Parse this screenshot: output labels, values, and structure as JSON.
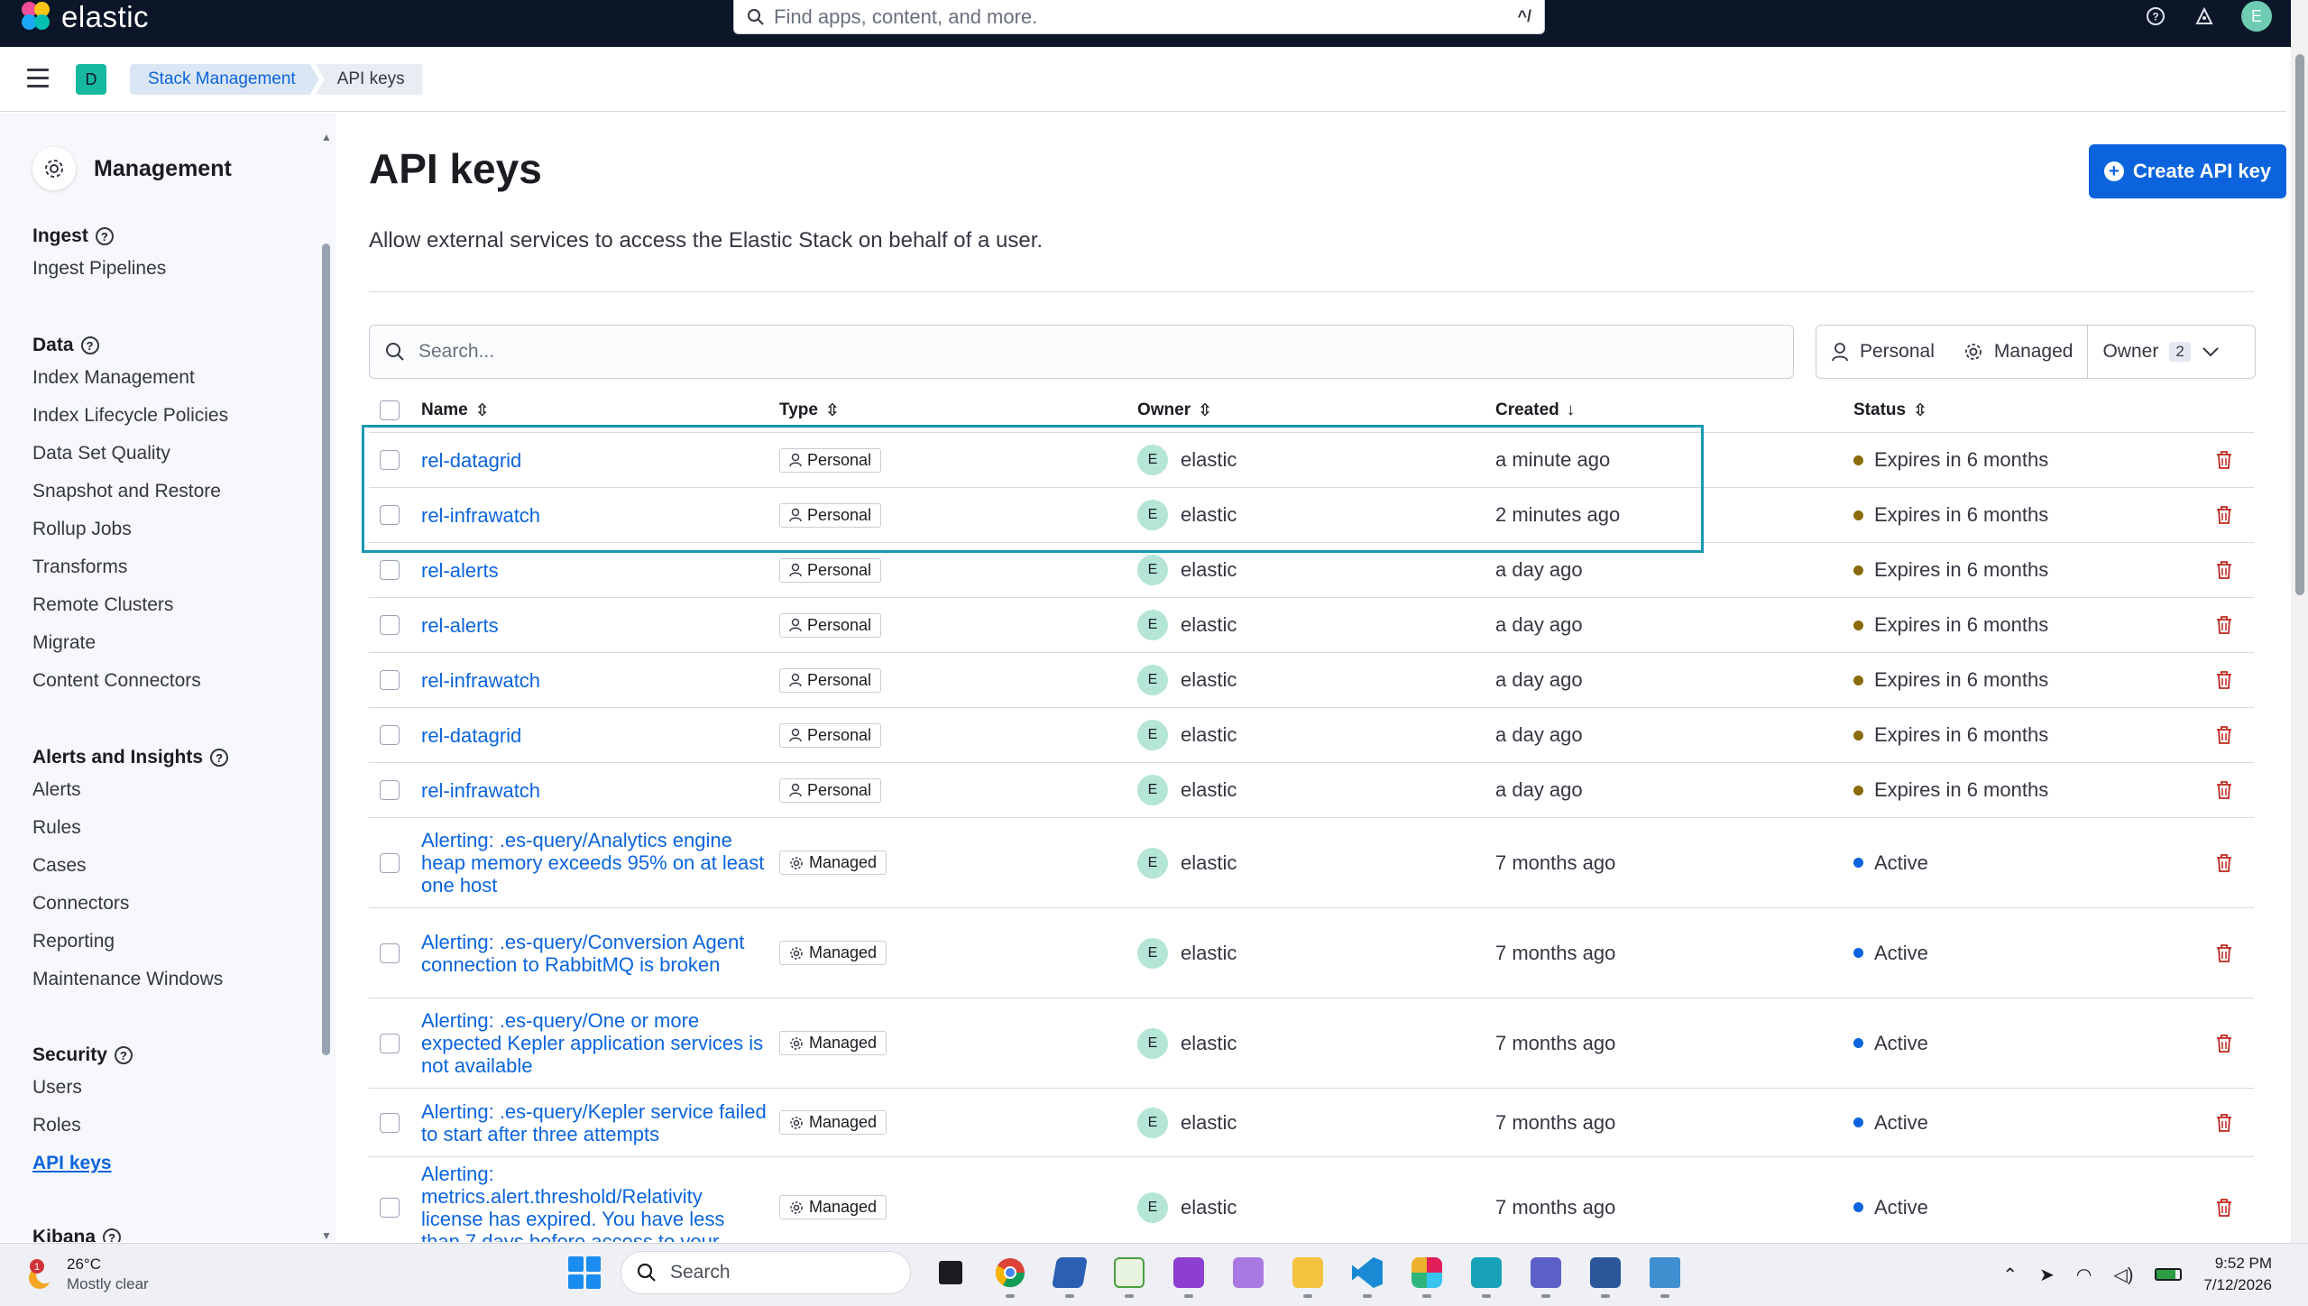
{
  "app": {
    "brand": "elastic",
    "search_placeholder": "Find apps, content, and more.",
    "search_shortcut": "^/",
    "user_initial": "E",
    "space_initial": "D"
  },
  "breadcrumbs": [
    "Stack Management",
    "API keys"
  ],
  "sidebar": {
    "title": "Management",
    "groups": [
      {
        "title": "Ingest",
        "items": [
          "Ingest Pipelines"
        ]
      },
      {
        "title": "Data",
        "items": [
          "Index Management",
          "Index Lifecycle Policies",
          "Data Set Quality",
          "Snapshot and Restore",
          "Rollup Jobs",
          "Transforms",
          "Remote Clusters",
          "Migrate",
          "Content Connectors"
        ]
      },
      {
        "title": "Alerts and Insights",
        "items": [
          "Alerts",
          "Rules",
          "Cases",
          "Connectors",
          "Reporting",
          "Maintenance Windows"
        ]
      },
      {
        "title": "Security",
        "items": [
          "Users",
          "Roles",
          "API keys"
        ]
      },
      {
        "title": "Kibana",
        "items": []
      }
    ],
    "active_item": "API keys"
  },
  "page": {
    "title": "API keys",
    "description": "Allow external services to access the Elastic Stack on behalf of a user.",
    "create_button": "Create API key",
    "search_placeholder": "Search...",
    "filters": {
      "personal": "Personal",
      "managed": "Managed",
      "owner": "Owner",
      "owner_count": "2"
    }
  },
  "table": {
    "columns": [
      "Name",
      "Type",
      "Owner",
      "Created",
      "Status"
    ],
    "rows": [
      {
        "name": "rel-datagrid",
        "type": "Personal",
        "owner": "elastic",
        "created": "a minute ago",
        "status": "Expires in 6 months"
      },
      {
        "name": "rel-infrawatch",
        "type": "Personal",
        "owner": "elastic",
        "created": "2 minutes ago",
        "status": "Expires in 6 months"
      },
      {
        "name": "rel-alerts",
        "type": "Personal",
        "owner": "elastic",
        "created": "a day ago",
        "status": "Expires in 6 months"
      },
      {
        "name": "rel-alerts",
        "type": "Personal",
        "owner": "elastic",
        "created": "a day ago",
        "status": "Expires in 6 months"
      },
      {
        "name": "rel-infrawatch",
        "type": "Personal",
        "owner": "elastic",
        "created": "a day ago",
        "status": "Expires in 6 months"
      },
      {
        "name": "rel-datagrid",
        "type": "Personal",
        "owner": "elastic",
        "created": "a day ago",
        "status": "Expires in 6 months"
      },
      {
        "name": "rel-infrawatch",
        "type": "Personal",
        "owner": "elastic",
        "created": "a day ago",
        "status": "Expires in 6 months"
      },
      {
        "name": "Alerting: .es-query/Analytics engine heap memory exceeds 95% on at least one host",
        "type": "Managed",
        "owner": "elastic",
        "created": "7 months ago",
        "status": "Active"
      },
      {
        "name": "Alerting: .es-query/Conversion Agent connection to RabbitMQ is broken",
        "type": "Managed",
        "owner": "elastic",
        "created": "7 months ago",
        "status": "Active"
      },
      {
        "name": "Alerting: .es-query/One or more expected Kepler application services is not available",
        "type": "Managed",
        "owner": "elastic",
        "created": "7 months ago",
        "status": "Active"
      },
      {
        "name": "Alerting: .es-query/Kepler service failed to start after three attempts",
        "type": "Managed",
        "owner": "elastic",
        "created": "7 months ago",
        "status": "Active"
      },
      {
        "name": "Alerting: metrics.alert.threshold/Relativity license has expired. You have less than 7 days before access to your",
        "type": "Managed",
        "owner": "elastic",
        "created": "7 months ago",
        "status": "Active"
      }
    ]
  },
  "colors": {
    "expires_dot": "#8a6a0a",
    "active_dot": "#0b64dd",
    "highlight": "#1798b0"
  },
  "taskbar": {
    "weather_temp": "26°C",
    "weather_desc": "Mostly clear",
    "weather_badge": "1",
    "search": "Search",
    "time": "9:52 PM",
    "date": "7/12/2026"
  }
}
